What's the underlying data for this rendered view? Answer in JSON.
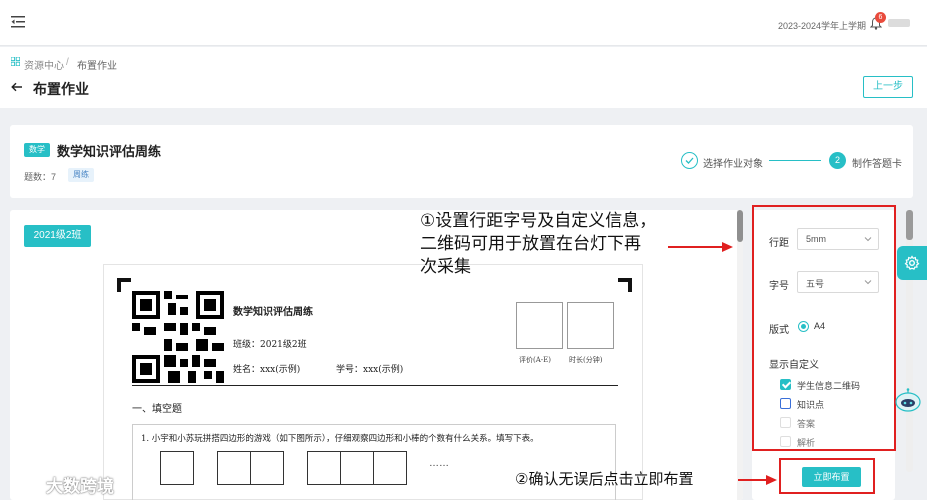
{
  "topbar": {
    "term": "2023-2024学年上学期",
    "notification_count": "6"
  },
  "breadcrumb": {
    "home": "资源中心",
    "separator": "/",
    "current": "布置作业"
  },
  "page": {
    "title": "布置作业",
    "prev_button": "上一步"
  },
  "homework": {
    "subject_tag": "数学",
    "title": "数学知识评估周练",
    "question_count_label": "题数：7",
    "cycle_tag": "周练"
  },
  "steps": [
    {
      "label": "选择作业对象",
      "state": "done"
    },
    {
      "number": "2",
      "label": "制作答题卡",
      "state": "active"
    }
  ],
  "class_tag": "2021级2班",
  "sheet": {
    "title": "数学知识评估周练",
    "class_line": "班级：2021级2班",
    "name_line": "姓名：xxx(示例)",
    "number_line": "学号：xxx(示例)",
    "score_label": "评价(A-E)",
    "time_label": "时长(分钟)",
    "section_title": "一、填空题",
    "question_1": "1.  小宇和小苏玩拼搭四边形的游戏（如下图所示），仔细观察四边形和小棒的个数有什么关系。填写下表。",
    "ellipsis": "……"
  },
  "annotations": {
    "note_1_line_1": "①设置行距字号及自定义信息，",
    "note_1_line_2": "二维码可用于放置在台灯下再",
    "note_1_line_3": "次采集",
    "note_2": "②确认无误后点击立即布置"
  },
  "settings": {
    "line_spacing_label": "行距",
    "line_spacing_value": "5mm",
    "font_size_label": "字号",
    "font_size_value": "五号",
    "layout_label": "版式",
    "layout_value": "A4",
    "custom_label": "显示自定义",
    "options": [
      {
        "label": "学生信息二维码",
        "checked": true
      },
      {
        "label": "知识点",
        "checked": false
      },
      {
        "label": "答案",
        "checked": false
      },
      {
        "label": "解析",
        "checked": false
      }
    ],
    "submit_button": "立即布置"
  },
  "watermark": "大数跨境",
  "colors": {
    "accent": "#27bfc6",
    "annotation_red": "#e02020",
    "badge_red": "#e94b3c"
  }
}
